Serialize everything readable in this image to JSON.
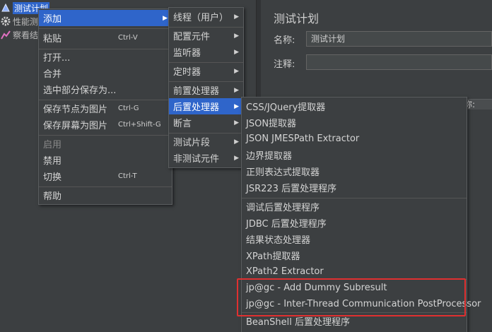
{
  "tree": {
    "items": [
      {
        "label": "测试计划",
        "icon": "test-plan-icon"
      },
      {
        "label": "性能测",
        "icon": "gear-icon"
      },
      {
        "label": "察看结",
        "icon": "listener-icon"
      }
    ]
  },
  "panel": {
    "title": "测试计划",
    "name_label": "名称:",
    "name_value": "测试计划",
    "comment_label": "注释:",
    "comment_value": "",
    "partial_header": "称:"
  },
  "menu1": {
    "items": [
      {
        "label": "添加",
        "submenu": true
      },
      {
        "label": "粘贴",
        "shortcut": "Ctrl-V"
      },
      {
        "label": "打开..."
      },
      {
        "label": "合并"
      },
      {
        "label": "选中部分保存为..."
      },
      {
        "label": "保存节点为图片",
        "shortcut": "Ctrl-G"
      },
      {
        "label": "保存屏幕为图片",
        "shortcut": "Ctrl+Shift-G"
      },
      {
        "label": "启用",
        "disabled": true
      },
      {
        "label": "禁用"
      },
      {
        "label": "切换",
        "shortcut": "Ctrl-T"
      },
      {
        "label": "帮助"
      }
    ]
  },
  "menu2": {
    "items": [
      {
        "label": "线程（用户）"
      },
      {
        "label": "配置元件"
      },
      {
        "label": "监听器"
      },
      {
        "label": "定时器"
      },
      {
        "label": "前置处理器"
      },
      {
        "label": "后置处理器"
      },
      {
        "label": "断言"
      },
      {
        "label": "测试片段"
      },
      {
        "label": "非测试元件"
      }
    ]
  },
  "menu3": {
    "items": [
      {
        "label": "CSS/JQuery提取器"
      },
      {
        "label": "JSON提取器"
      },
      {
        "label": "JSON JMESPath Extractor"
      },
      {
        "label": "边界提取器"
      },
      {
        "label": "正则表达式提取器"
      },
      {
        "label": "JSR223 后置处理程序"
      },
      {
        "label": "调试后置处理程序"
      },
      {
        "label": "JDBC 后置处理程序"
      },
      {
        "label": "结果状态处理器"
      },
      {
        "label": "XPath提取器"
      },
      {
        "label": "XPath2 Extractor"
      },
      {
        "label": "jp@gc - Add Dummy Subresult"
      },
      {
        "label": "jp@gc - Inter-Thread Communication PostProcessor"
      },
      {
        "label": "BeanShell 后置处理程序"
      }
    ]
  },
  "colors": {
    "highlight": "#2f65ca",
    "annotation": "#e03030",
    "background": "#3c3f41"
  }
}
